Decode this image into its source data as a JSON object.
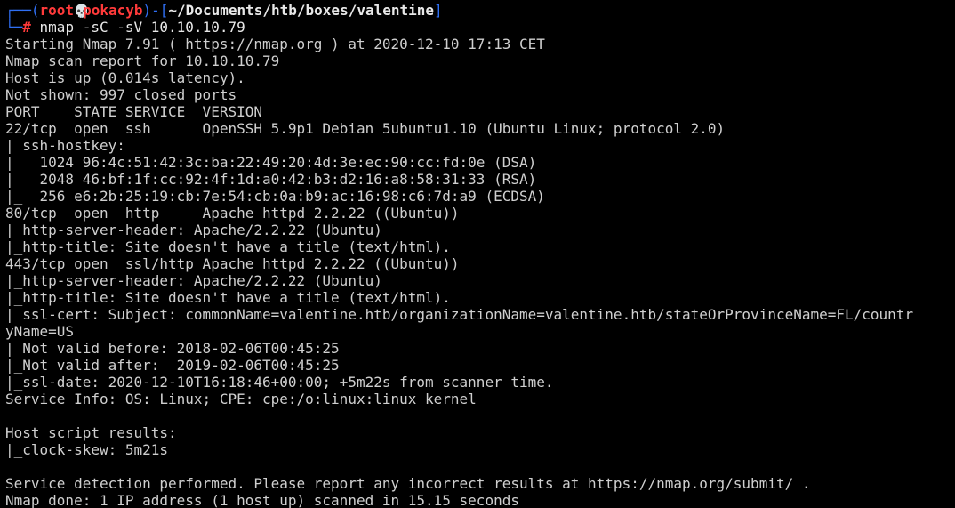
{
  "prompt": {
    "bracket_open": "┌──(",
    "user": "root",
    "skull_icon": "💀",
    "host": "pokacyb",
    "bracket_mid": ")-[",
    "cwd": "~/Documents/htb/boxes/valentine",
    "bracket_close": "]",
    "line2_corner": "└─",
    "symbol": "#",
    "command": " nmap -sC -sV 10.10.10.79"
  },
  "output_lines": [
    "Starting Nmap 7.91 ( https://nmap.org ) at 2020-12-10 17:13 CET",
    "Nmap scan report for 10.10.10.79",
    "Host is up (0.014s latency).",
    "Not shown: 997 closed ports",
    "PORT    STATE SERVICE  VERSION",
    "22/tcp  open  ssh      OpenSSH 5.9p1 Debian 5ubuntu1.10 (Ubuntu Linux; protocol 2.0)",
    "| ssh-hostkey:",
    "|   1024 96:4c:51:42:3c:ba:22:49:20:4d:3e:ec:90:cc:fd:0e (DSA)",
    "|   2048 46:bf:1f:cc:92:4f:1d:a0:42:b3:d2:16:a8:58:31:33 (RSA)",
    "|_  256 e6:2b:25:19:cb:7e:54:cb:0a:b9:ac:16:98:c6:7d:a9 (ECDSA)",
    "80/tcp  open  http     Apache httpd 2.2.22 ((Ubuntu))",
    "|_http-server-header: Apache/2.2.22 (Ubuntu)",
    "|_http-title: Site doesn't have a title (text/html).",
    "443/tcp open  ssl/http Apache httpd 2.2.22 ((Ubuntu))",
    "|_http-server-header: Apache/2.2.22 (Ubuntu)",
    "|_http-title: Site doesn't have a title (text/html).",
    "| ssl-cert: Subject: commonName=valentine.htb/organizationName=valentine.htb/stateOrProvinceName=FL/countr",
    "yName=US",
    "| Not valid before: 2018-02-06T00:45:25",
    "|_Not valid after:  2019-02-06T00:45:25",
    "|_ssl-date: 2020-12-10T16:18:46+00:00; +5m22s from scanner time.",
    "Service Info: OS: Linux; CPE: cpe:/o:linux:linux_kernel",
    "",
    "Host script results:",
    "|_clock-skew: 5m21s",
    "",
    "Service detection performed. Please report any incorrect results at https://nmap.org/submit/ .",
    "Nmap done: 1 IP address (1 host up) scanned in 15.15 seconds"
  ],
  "colors": {
    "background": "#000000",
    "text": "#cfcfcf",
    "prompt_frame": "#2f6ff3",
    "prompt_user": "#ff3a3a"
  }
}
